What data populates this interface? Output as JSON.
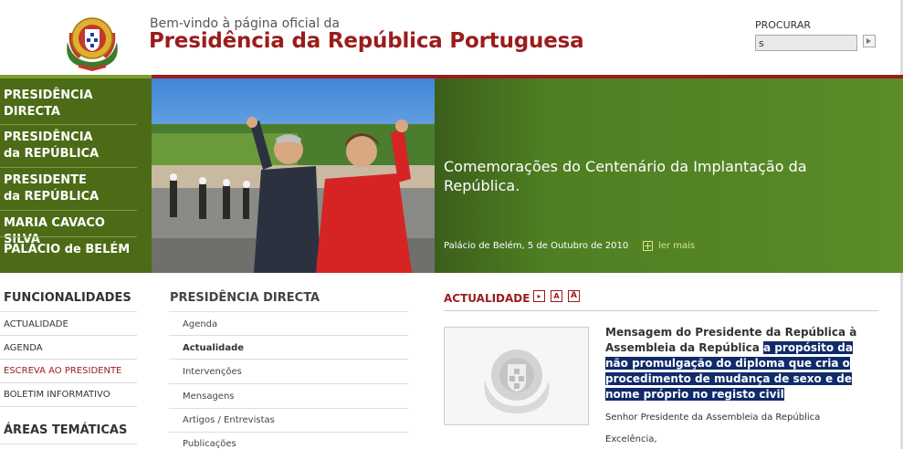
{
  "header": {
    "welcome": "Bem-vindo à página oficial da",
    "title": "Presidência da República Portuguesa"
  },
  "search": {
    "label": "PROCURAR",
    "value": "s"
  },
  "main_nav": [
    {
      "line1": "PRESIDÊNCIA",
      "line2": "DIRECTA"
    },
    {
      "line1": "PRESIDÊNCIA",
      "line2": "da REPÚBLICA"
    },
    {
      "line1": "PRESIDENTE",
      "line2": "da REPÚBLICA"
    },
    {
      "line1": "MARIA CAVACO SILVA",
      "line2": ""
    },
    {
      "line1": "PALÁCIO de BELÉM",
      "line2": ""
    }
  ],
  "banner": {
    "headline": "Comemorações do Centenário da Implantação da República.",
    "meta": "Palácio de Belém, 5 de Outubro de 2010",
    "more": "ler mais"
  },
  "funcionalidades": {
    "title": "FUNCIONALIDADES",
    "items": [
      "ACTUALIDADE",
      "AGENDA",
      "ESCREVA AO PRESIDENTE",
      "BOLETIM INFORMATIVO"
    ]
  },
  "areas": {
    "title": "ÁREAS TEMÁTICAS"
  },
  "presidencia_directa": {
    "title": "PRESIDÊNCIA DIRECTA",
    "items": [
      "Agenda",
      "Actualidade",
      "Intervenções",
      "Mensagens",
      "Artigos / Entrevistas",
      "Publicações"
    ]
  },
  "actualidade": {
    "title": "ACTUALIDADE",
    "tools": [
      "A",
      "A"
    ],
    "news_title_part1": "Mensagem do Presidente da República à Assembleia da República ",
    "news_title_part2": "a propósito da não promulgação do diploma que cria o procedimento de mudança de sexo e de nome próprio no registo civil",
    "body1": "Senhor Presidente da Assembleia da República",
    "body2": "Excelência,"
  },
  "colors": {
    "brand_red": "#9b1c1c",
    "nav_green": "#4b6b16",
    "highlight": "#102a6a"
  }
}
